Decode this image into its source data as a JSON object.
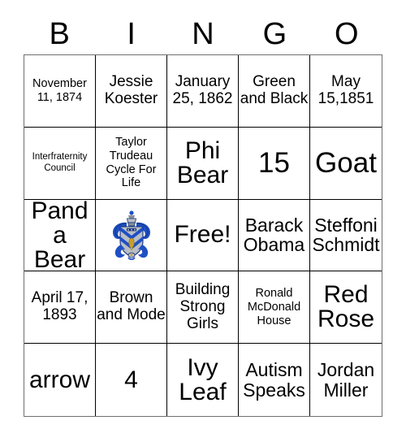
{
  "card": {
    "title_letters": [
      "B",
      "I",
      "N",
      "G",
      "O"
    ],
    "free_space_label": "Free!",
    "colors": {
      "grid_border": "#000000",
      "outer_border": "#6f6f6f",
      "text": "#000000",
      "background": "#ffffff",
      "crest_blue": "#1f4fc4",
      "crest_blue_dark": "#12317d",
      "crest_silver": "#b9bec4",
      "crest_gray": "#8a9097",
      "crest_gold": "#c8a02a"
    },
    "rows": [
      [
        {
          "text": "November 11, 1874",
          "size": "fs-s"
        },
        {
          "text": "Jessie Koester",
          "size": "fs-m"
        },
        {
          "text": "January 25, 1862",
          "size": "fs-m"
        },
        {
          "text": "Green and Black",
          "size": "fs-m"
        },
        {
          "text": "May 15,1851",
          "size": "fs-m"
        }
      ],
      [
        {
          "text": "Interfraternity Council",
          "size": "fs-xs"
        },
        {
          "text": "Taylor Trudeau Cycle For Life",
          "size": "fs-s"
        },
        {
          "text": "Phi Bear",
          "size": "fs-xl"
        },
        {
          "text": "15",
          "size": "fs-xxl"
        },
        {
          "text": "Goat",
          "size": "fs-xxl"
        }
      ],
      [
        {
          "text": "Panda Bear",
          "size": "fs-xl"
        },
        {
          "text": "",
          "size": "fs-m",
          "icon": "fraternity-crest-icon"
        },
        {
          "text": "Free!",
          "size": "fs-xl"
        },
        {
          "text": "Barack Obama",
          "size": "fs-l"
        },
        {
          "text": "Steffoni Schmidt",
          "size": "fs-l"
        }
      ],
      [
        {
          "text": "April 17, 1893",
          "size": "fs-m"
        },
        {
          "text": "Brown and Mode",
          "size": "fs-m"
        },
        {
          "text": "Building Strong Girls",
          "size": "fs-m"
        },
        {
          "text": "Ronald McDonald House",
          "size": "fs-s"
        },
        {
          "text": "Red Rose",
          "size": "fs-xl"
        }
      ],
      [
        {
          "text": "arrow",
          "size": "fs-xl"
        },
        {
          "text": "4",
          "size": "fs-xl"
        },
        {
          "text": "Ivy Leaf",
          "size": "fs-xl"
        },
        {
          "text": "Autism Speaks",
          "size": "fs-l"
        },
        {
          "text": "Jordan Miller",
          "size": "fs-l"
        }
      ]
    ]
  }
}
